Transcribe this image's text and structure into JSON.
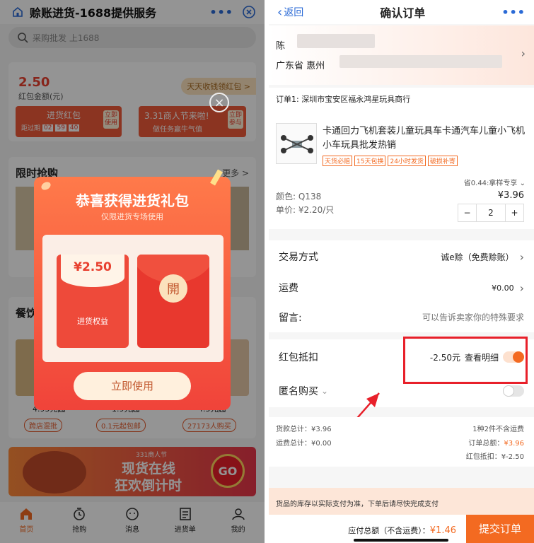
{
  "left": {
    "title": "赊账进货-1688提供服务",
    "more": "•••",
    "search_placeholder": "采购批发 上1688",
    "redpack_amount": "2.50",
    "redpack_label": "红包金额(元)",
    "earn_link": "天天收钱领红包 >",
    "card1_title": "进货红包",
    "card1_expire_prefix": "距过期",
    "countdown": [
      "02",
      "59",
      "40"
    ],
    "card1_btn": "立即使用",
    "card2_title": "3.31商人节来啦!",
    "card2_sub": "做任务赢牛气值",
    "card2_btn": "立即参与",
    "section1": "限时抢购",
    "section1_more": "更多 >",
    "section2": "餐饮",
    "prices": [
      "4.95元起",
      "1.9元起",
      "4.5元起"
    ],
    "badges": [
      "跨店混批",
      "0.1元起包邮",
      "27173人购买"
    ],
    "banner_small": "331商人节",
    "banner_line1": "现货在线",
    "banner_line2": "狂欢倒计时",
    "banner_go": "GO",
    "modal": {
      "title": "恭喜获得进货礼包",
      "subtitle": "仅限进货专场使用",
      "envelope_amount": "¥2.50",
      "envelope_label": "进货权益",
      "open_char": "開",
      "use_button": "立即使用",
      "close": "×"
    },
    "tabs": [
      {
        "label": "首页",
        "icon": "home-icon"
      },
      {
        "label": "抢购",
        "icon": "timer-icon"
      },
      {
        "label": "消息",
        "icon": "message-icon"
      },
      {
        "label": "进货单",
        "icon": "order-list-icon"
      },
      {
        "label": "我的",
        "icon": "profile-icon"
      }
    ]
  },
  "right": {
    "back": "返回",
    "title": "确认订单",
    "more": "•••",
    "addr_name": "陈",
    "addr_region": "广东省 惠州",
    "order_shop": "订单1: 深圳市宝安区福永鸿星玩具商行",
    "product_title": "卡通回力飞机套装儿童玩具车卡通汽车儿童小飞机小车玩具批发热销",
    "product_tags": [
      "天货必赔",
      "15天包换",
      "24小时发货",
      "破损补寄"
    ],
    "save_tip": "省0.44:拿样专享",
    "color": "颜色: Q138",
    "unit_price": "单价: ¥2.20/只",
    "line_price": "¥3.96",
    "qty": "2",
    "minus": "−",
    "plus": "+",
    "trade_label": "交易方式",
    "trade_value": "诚e赊（免费赊账）",
    "freight_label": "运费",
    "freight_value": "¥0.00",
    "memo_label": "留言:",
    "memo_placeholder": "可以告诉卖家你的特殊要求",
    "redpack_label": "红包抵扣",
    "redpack_value": "-2.50元",
    "redpack_detail": "查看明细",
    "anon_label": "匿名购买",
    "goods_total": "货款总计：¥3.96",
    "freight_total": "运费总计：¥0.00",
    "summary_count": "1种2件不含运费",
    "order_total_label": "订单总额：",
    "order_total": "¥3.96",
    "redpack_deduct": "红包抵扣：¥-2.50",
    "stock_note": "货品的库存以实际支付为准，下单后请尽快完成支付",
    "payable_label": "应付总额（不含运费）：",
    "payable": "¥1.46",
    "submit": "提交订单"
  },
  "colors": {
    "accent": "#f36a21",
    "red": "#e8402f",
    "highlight_box": "#e8202a"
  }
}
